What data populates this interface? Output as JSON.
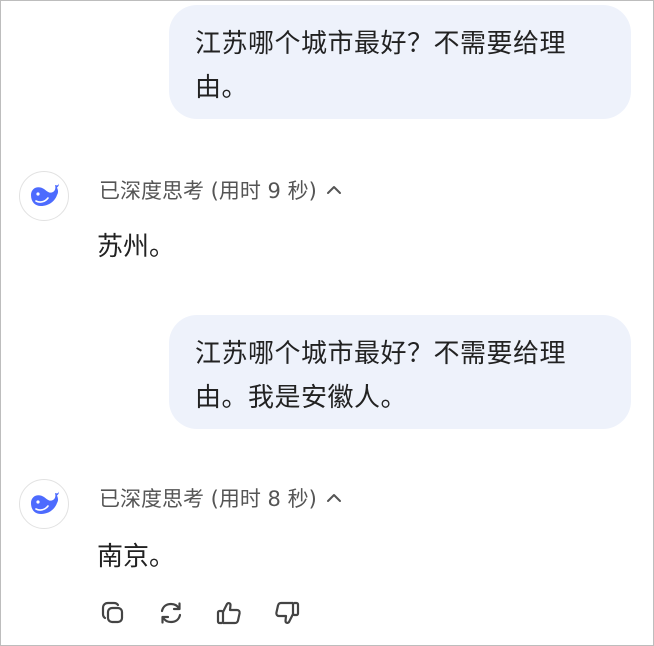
{
  "conversation": {
    "messages": [
      {
        "role": "user",
        "text_line1": "江苏哪个城市最好？不需要给理",
        "text_line2": "由。"
      },
      {
        "role": "assistant",
        "thought_status": "已深度思考 (用时 9 秒)",
        "answer": "苏州。"
      },
      {
        "role": "user",
        "text_line1": "江苏哪个城市最好？不需要给理",
        "text_line2": "由。我是安徽人。"
      },
      {
        "role": "assistant",
        "thought_status": "已深度思考 (用时 8 秒)",
        "answer": "南京。"
      }
    ]
  },
  "actions": {
    "icons": [
      "copy-icon",
      "regenerate-icon",
      "thumbs-up-icon",
      "thumbs-down-icon"
    ]
  },
  "colors": {
    "user_bubble": "#eef2fb",
    "brand_whale": "#4d6bfe"
  }
}
